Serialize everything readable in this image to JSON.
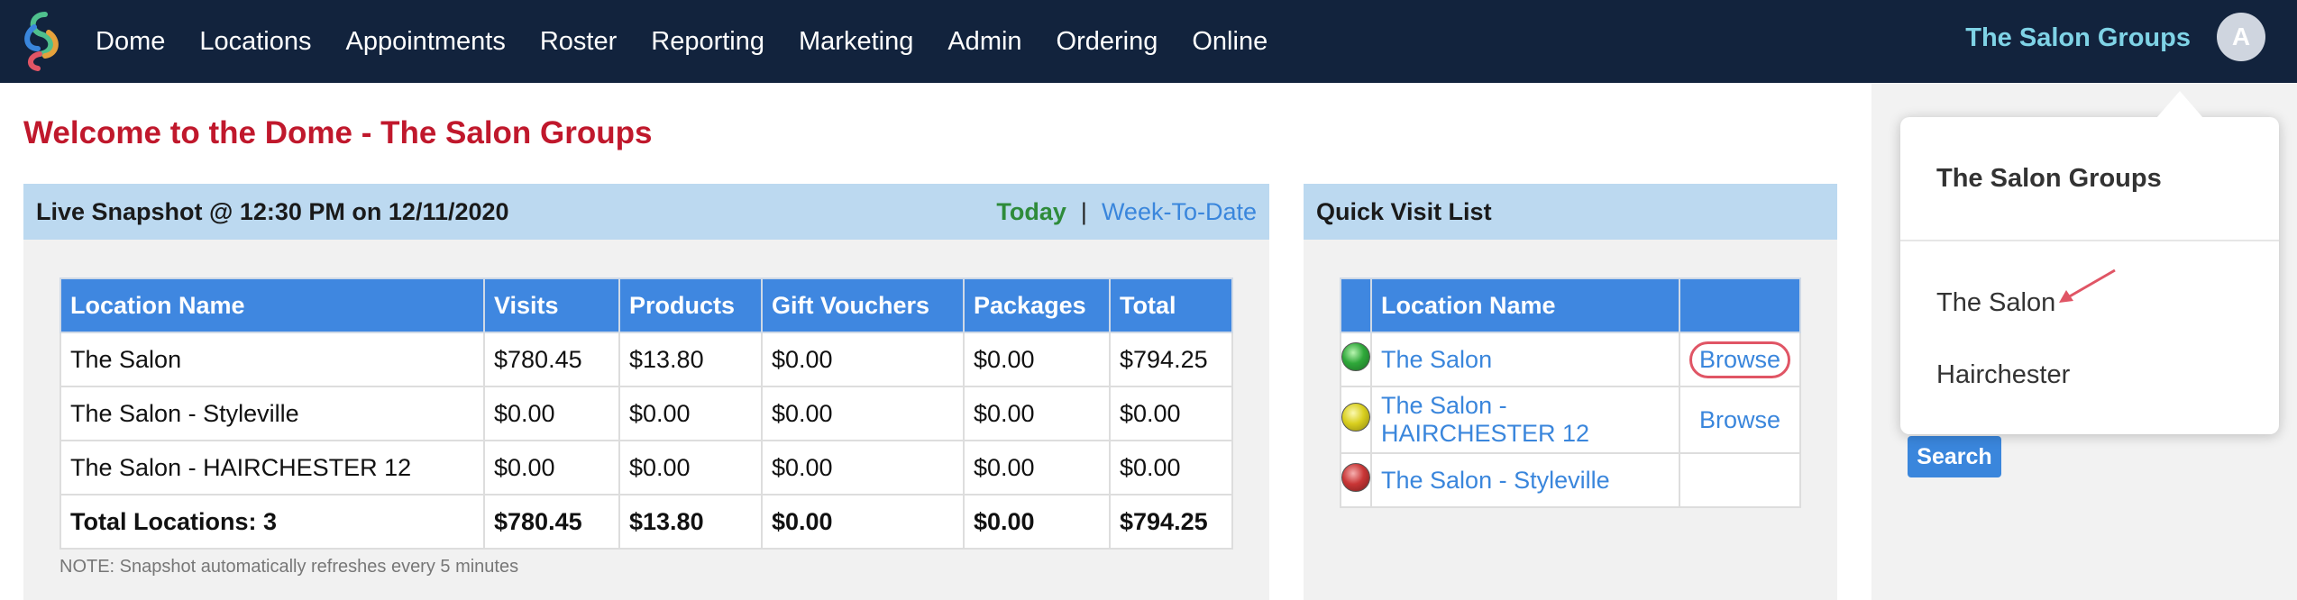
{
  "nav": {
    "items": [
      "Dome",
      "Locations",
      "Appointments",
      "Roster",
      "Reporting",
      "Marketing",
      "Admin",
      "Ordering",
      "Online"
    ],
    "org_name": "The Salon Groups",
    "avatar_initial": "A"
  },
  "welcome": "Welcome to the Dome - The Salon Groups",
  "snapshot": {
    "title": "Live Snapshot @ 12:30 PM on 12/11/2020",
    "today_label": "Today",
    "separator": "|",
    "wtd_label": "Week-To-Date",
    "columns": [
      "Location Name",
      "Visits",
      "Products",
      "Gift Vouchers",
      "Packages",
      "Total"
    ],
    "rows": [
      [
        "The Salon",
        "$780.45",
        "$13.80",
        "$0.00",
        "$0.00",
        "$794.25"
      ],
      [
        "The Salon - Styleville",
        "$0.00",
        "$0.00",
        "$0.00",
        "$0.00",
        "$0.00"
      ],
      [
        "The Salon - HAIRCHESTER 12",
        "$0.00",
        "$0.00",
        "$0.00",
        "$0.00",
        "$0.00"
      ]
    ],
    "total_row": [
      "Total Locations: 3",
      "$780.45",
      "$13.80",
      "$0.00",
      "$0.00",
      "$794.25"
    ],
    "note": "NOTE: Snapshot automatically refreshes every 5 minutes"
  },
  "quick_visit": {
    "title": "Quick Visit List",
    "column_location": "Location Name",
    "rows": [
      {
        "status": "green",
        "location": "The Salon",
        "browse": "Browse"
      },
      {
        "status": "yellow",
        "location": "The Salon - HAIRCHESTER 12",
        "browse": "Browse"
      },
      {
        "status": "red",
        "location": "The Salon - Styleville",
        "browse": ""
      }
    ]
  },
  "dropdown": {
    "header": "The Salon Groups",
    "items": [
      "The Salon",
      "Hairchester"
    ]
  },
  "search_label": "Search",
  "colors": {
    "navbar": "#12233d",
    "welcome_red": "#c0182c",
    "table_header_blue": "#3f87e0",
    "panel_header": "#bcd9f0",
    "link_blue": "#3a86dc",
    "today_green": "#2e8b3a",
    "org_teal": "#7fd3e6",
    "annotation_red": "#e05565"
  }
}
